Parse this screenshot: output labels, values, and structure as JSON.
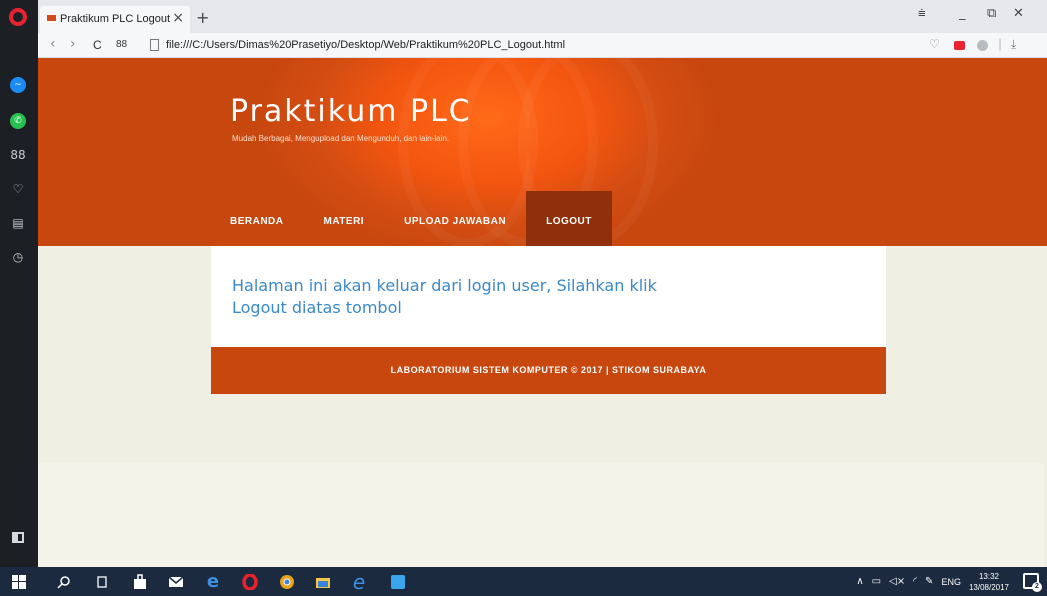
{
  "browser": {
    "tab_title": "Praktikum PLC Logout",
    "tab_close": "×",
    "new_tab": "+",
    "address_url": "file:///C:/Users/Dimas%20Prasetiyo/Desktop/Web/Praktikum%20PLC_Logout.html",
    "nav_back": "‹",
    "nav_forward": "›",
    "reload": "C",
    "speed_dial": "88",
    "window_controls": [
      "⩧",
      "_",
      "⧉",
      "✕"
    ],
    "right_icons": [
      "♡",
      "|",
      "⤓"
    ]
  },
  "sidebar": {
    "icons": [
      "messenger-icon",
      "whatsapp-icon",
      "speed-dial-icon",
      "heart-icon",
      "news-icon",
      "history-icon"
    ],
    "labels": {
      "speeddial": "88",
      "heart": "♡",
      "news": "▤",
      "history": "◷",
      "messenger": "~",
      "whatsapp": "✆"
    }
  },
  "page": {
    "site_title": "Praktikum PLC",
    "tagline": "Mudah Berbagai, Mengupload dan Mengunduh, dan lain-lain.",
    "nav": [
      {
        "label": "BERANDA",
        "active": false
      },
      {
        "label": "MATERI",
        "active": false
      },
      {
        "label": "UPLOAD JAWABAN",
        "active": false
      },
      {
        "label": "LOGOUT",
        "active": true
      }
    ],
    "content_text": "Halaman ini akan keluar dari login user, Silahkan klik Logout diatas tombol",
    "footer_text": "LABORATORIUM SISTEM KOMPUTER © 2017 | STIKOM SURABAYA"
  },
  "colors": {
    "header_orange": "#c8470f",
    "nav_active": "#8f2f0b",
    "content_blue": "#3a89c9",
    "page_bg": "#f0efe4",
    "taskbar": "#1b2a3f"
  },
  "taskbar": {
    "icons": [
      "windows-start-icon",
      "search-icon",
      "task-view-icon",
      "store-icon",
      "mail-icon",
      "edge-icon",
      "opera-icon",
      "chrome-icon",
      "file-explorer-icon",
      "internet-explorer-icon",
      "sway-icon"
    ],
    "tray": {
      "language": "ENG",
      "time": "13:32",
      "date": "13/08/2017",
      "notification_count": "2"
    }
  }
}
